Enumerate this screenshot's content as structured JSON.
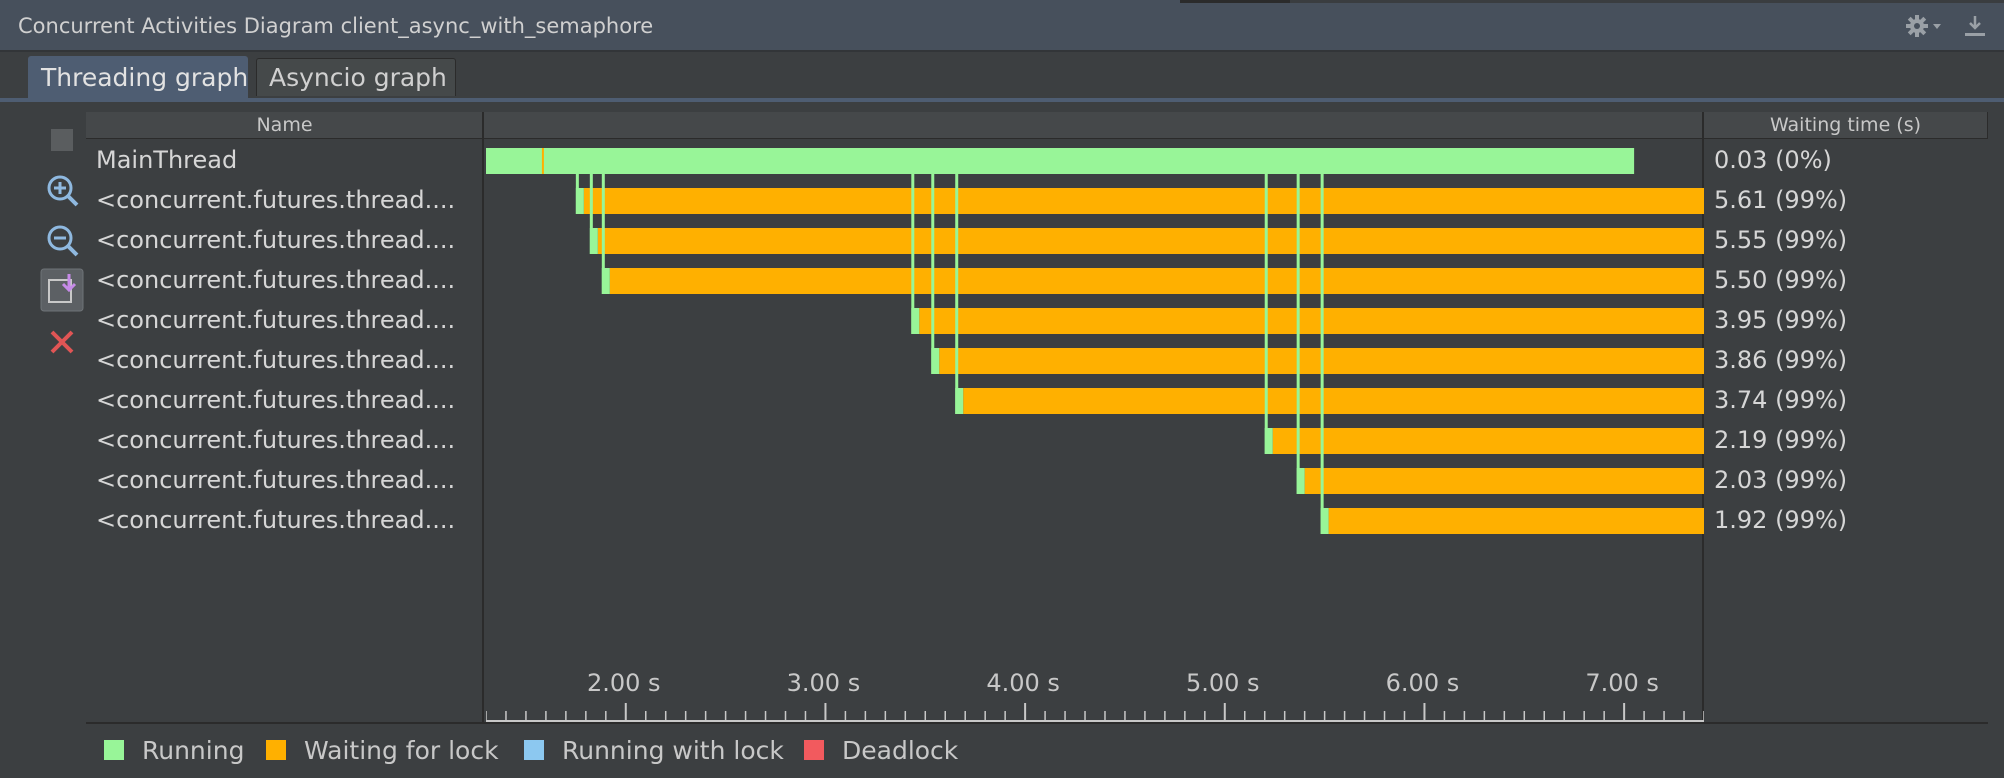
{
  "window": {
    "title": "Concurrent Activities Diagram client_async_with_semaphore"
  },
  "tabs": [
    {
      "label": "Threading graph",
      "active": true
    },
    {
      "label": "Asyncio graph",
      "active": false
    }
  ],
  "toolbar": {
    "icons": [
      "stop-icon",
      "zoom-in-icon",
      "zoom-out-icon",
      "scroll-to-end-icon",
      "close-icon"
    ]
  },
  "table": {
    "headers": {
      "name": "Name",
      "graph": "",
      "waiting": "Waiting time (s)"
    },
    "rows": [
      {
        "name": "MainThread",
        "waiting": "0.03 (0%)"
      },
      {
        "name": "<concurrent.futures.thread....",
        "waiting": "5.61 (99%)"
      },
      {
        "name": "<concurrent.futures.thread....",
        "waiting": "5.55 (99%)"
      },
      {
        "name": "<concurrent.futures.thread....",
        "waiting": "5.50 (99%)"
      },
      {
        "name": "<concurrent.futures.thread....",
        "waiting": "3.95 (99%)"
      },
      {
        "name": "<concurrent.futures.thread....",
        "waiting": "3.86 (99%)"
      },
      {
        "name": "<concurrent.futures.thread....",
        "waiting": "3.74 (99%)"
      },
      {
        "name": "<concurrent.futures.thread....",
        "waiting": "2.19 (99%)"
      },
      {
        "name": "<concurrent.futures.thread....",
        "waiting": "2.03 (99%)"
      },
      {
        "name": "<concurrent.futures.thread....",
        "waiting": "1.92 (99%)"
      }
    ]
  },
  "timeline": {
    "t_start": 1.3,
    "t_end": 7.4,
    "ticks": [
      "2.00 s",
      "3.00 s",
      "4.00 s",
      "5.00 s",
      "6.00 s",
      "7.00 s"
    ],
    "tick_values": [
      2,
      3,
      4,
      5,
      6,
      7
    ],
    "threads": [
      {
        "segments": [
          {
            "state": "running",
            "from": 1.3,
            "to": 7.05
          }
        ],
        "markers": [
          {
            "state": "waiting",
            "at": 1.58
          }
        ]
      },
      {
        "start": 1.75,
        "wait_from": 1.79
      },
      {
        "start": 1.82,
        "wait_from": 1.86
      },
      {
        "start": 1.88,
        "wait_from": 1.92
      },
      {
        "start": 3.43,
        "wait_from": 3.47
      },
      {
        "start": 3.53,
        "wait_from": 3.57
      },
      {
        "start": 3.65,
        "wait_from": 3.69
      },
      {
        "start": 5.2,
        "wait_from": 5.24
      },
      {
        "start": 5.36,
        "wait_from": 5.4
      },
      {
        "start": 5.48,
        "wait_from": 5.52
      }
    ]
  },
  "legend": [
    {
      "label": "Running",
      "color": "#98f598"
    },
    {
      "label": "Waiting for lock",
      "color": "#ffb000"
    },
    {
      "label": "Running with lock",
      "color": "#8cc8f0"
    },
    {
      "label": "Deadlock",
      "color": "#f25a5e"
    }
  ],
  "colors": {
    "running": "#98f598",
    "waiting": "#ffb000",
    "background": "#3c3f41"
  }
}
